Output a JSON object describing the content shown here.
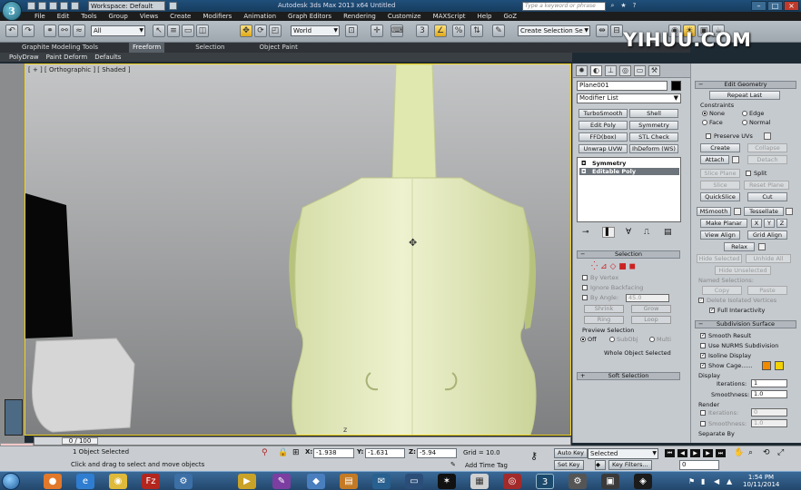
{
  "titlebar": {
    "workspace": "Workspace: Default",
    "title": "Autodesk 3ds Max  2013 x64     Untitled",
    "search_placeholder": "Type a keyword or phrase"
  },
  "menu": [
    "File",
    "Edit",
    "Tools",
    "Group",
    "Views",
    "Create",
    "Modifiers",
    "Animation",
    "Graph Editors",
    "Rendering",
    "Customize",
    "MAXScript",
    "Help",
    "GoZ"
  ],
  "toolbar": {
    "filter_value": "All",
    "coord_system": "World",
    "named_selection": "Create Selection Se"
  },
  "watermark": "YIHUU.COM",
  "ribbon": {
    "tabs": [
      "Graphite Modeling Tools",
      "Freeform",
      "Selection",
      "Object Paint"
    ],
    "active": "Freeform",
    "subtabs": [
      "PolyDraw",
      "Paint Deform",
      "Defaults"
    ]
  },
  "viewport": {
    "label": "[ + ] [ Orthographic ] [ Shaded ]"
  },
  "timeline": {
    "frame": "0 / 100"
  },
  "status": {
    "selected": "1 Object Selected",
    "prompt": "Click and drag to select and move objects",
    "x_label": "X:",
    "x": "-1.938",
    "y_label": "Y:",
    "y": "-1.631",
    "z_label": "Z:",
    "z": "-5.94",
    "grid": "Grid = 10.0",
    "add_time_tag": "Add Time Tag",
    "auto_key": "Auto Key",
    "set_key": "Set Key",
    "key_mode": "Selected",
    "key_filters": "Key Filters...",
    "frame_field": "0"
  },
  "command_panel": {
    "object_name": "Plane001",
    "modifier_list": "Modifier List",
    "modifier_buttons": [
      "TurboSmooth",
      "Shell",
      "Edit Poly",
      "Symmetry",
      "FFD(box)",
      "STL Check",
      "Unwrap UVW",
      "IhDeform (WS)"
    ],
    "stack": [
      "Symmetry",
      "Editable Poly"
    ],
    "selection_header": "Selection",
    "by_vertex": "By Vertex",
    "ignore_backfacing": "Ignore Backfacing",
    "by_angle": "By Angle:",
    "by_angle_value": "45.0",
    "shrink": "Shrink",
    "grow": "Grow",
    "ring": "Ring",
    "loop": "Loop",
    "preview_selection": "Preview Selection",
    "preview_off": "Off",
    "preview_subobj": "SubObj",
    "preview_multi": "Multi",
    "whole_object": "Whole Object Selected",
    "soft_selection": "Soft Selection"
  },
  "edit_geometry": {
    "header": "Edit Geometry",
    "repeat_last": "Repeat Last",
    "constraints": "Constraints",
    "none": "None",
    "edge": "Edge",
    "face": "Face",
    "normal": "Normal",
    "preserve_uvs": "Preserve UVs",
    "create": "Create",
    "collapse": "Collapse",
    "attach": "Attach",
    "detach": "Detach",
    "slice_plane": "Slice Plane",
    "split": "Split",
    "slice": "Slice",
    "reset_plane": "Reset Plane",
    "quickslice": "QuickSlice",
    "cut": "Cut",
    "msmooth": "MSmooth",
    "tessellate": "Tessellate",
    "make_planar": "Make Planar",
    "x": "X",
    "y": "Y",
    "z": "Z",
    "view_align": "View Align",
    "grid_align": "Grid Align",
    "relax": "Relax",
    "hide_selected": "Hide Selected",
    "unhide_all": "Unhide All",
    "hide_unselected": "Hide Unselected",
    "named_selections": "Named Selections:",
    "copy": "Copy",
    "paste": "Paste",
    "delete_isolated": "Delete Isolated Vertices",
    "full_interactivity": "Full Interactivity"
  },
  "subdivision": {
    "header": "Subdivision Surface",
    "smooth_result": "Smooth Result",
    "use_nurms": "Use NURMS Subdivision",
    "isoline": "Isoline Display",
    "show_cage": "Show Cage......",
    "cage_color_1": "#f08a00",
    "cage_color_2": "#f2d200",
    "display": "Display",
    "iterations_label": "Iterations:",
    "iterations": "1",
    "smoothness_label": "Smoothness:",
    "smoothness": "1.0",
    "render": "Render",
    "render_iterations": "0",
    "render_smoothness": "1.0",
    "separate_by": "Separate By"
  },
  "taskbar": {
    "time": "1:54 PM",
    "date": "10/11/2014"
  },
  "colors": {
    "viewport_border": "#f2d21a",
    "violin_body": "#e3eab8"
  }
}
